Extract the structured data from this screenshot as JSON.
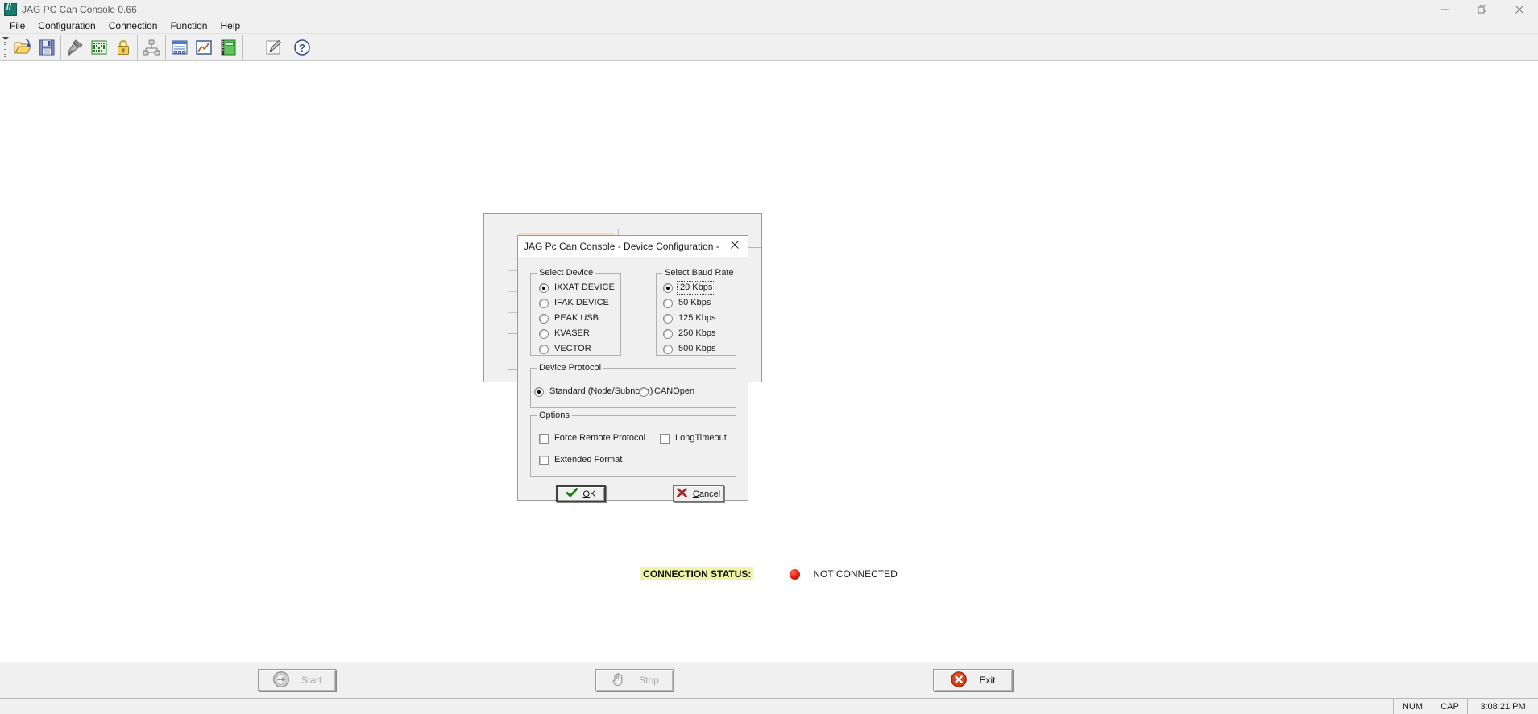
{
  "window": {
    "title": "JAG PC Can Console 0.66",
    "icon": "app-logo-icon",
    "controls": {
      "minimize": "minimize-icon",
      "restore": "restore-icon",
      "close": "close-icon"
    }
  },
  "menubar": {
    "items": [
      {
        "label": "File"
      },
      {
        "label": "Configuration"
      },
      {
        "label": "Connection"
      },
      {
        "label": "Function"
      },
      {
        "label": "Help"
      }
    ]
  },
  "toolbar": {
    "groups": [
      {
        "buttons": [
          {
            "name": "open-file-icon"
          },
          {
            "name": "save-file-icon"
          }
        ]
      },
      {
        "buttons": [
          {
            "name": "tools-hammer-icon"
          },
          {
            "name": "circuit-board-icon"
          },
          {
            "name": "padlock-icon"
          }
        ]
      },
      {
        "buttons": [
          {
            "name": "network-nodes-icon"
          }
        ]
      },
      {
        "buttons": [
          {
            "name": "list-report-icon"
          },
          {
            "name": "line-chart-icon"
          },
          {
            "name": "green-book-icon"
          }
        ]
      },
      {
        "buttons": [
          {
            "name": "edit-pencil-icon"
          }
        ]
      },
      {
        "buttons": [
          {
            "name": "help-question-icon"
          }
        ]
      }
    ]
  },
  "dialog": {
    "title": "JAG Pc Can Console - Device Configuration -",
    "close_icon": "close-icon",
    "select_device": {
      "legend": "Select Device",
      "options": [
        {
          "label": "IXXAT DEVICE",
          "checked": true
        },
        {
          "label": "IFAK  DEVICE",
          "checked": false
        },
        {
          "label": "PEAK USB",
          "checked": false
        },
        {
          "label": "KVASER",
          "checked": false
        },
        {
          "label": "VECTOR",
          "checked": false
        }
      ]
    },
    "select_baud_rate": {
      "legend": "Select Baud Rate",
      "options": [
        {
          "label": "20  Kbps",
          "checked": true,
          "focused": true
        },
        {
          "label": "50  Kbps",
          "checked": false,
          "focused": false
        },
        {
          "label": "125  Kbps",
          "checked": false,
          "focused": false
        },
        {
          "label": "250  Kbps",
          "checked": false,
          "focused": false
        },
        {
          "label": "500  Kbps",
          "checked": false,
          "focused": false
        }
      ]
    },
    "device_protocol": {
      "legend": "Device Protocol",
      "options": [
        {
          "label": "Standard (Node/Subnode)",
          "checked": true
        },
        {
          "label": "CANOpen",
          "checked": false
        }
      ]
    },
    "options": {
      "legend": "Options",
      "checkboxes": [
        {
          "label": "Force Remote Protocol",
          "checked": false
        },
        {
          "label": "LongTimeout",
          "checked": false
        },
        {
          "label": "Extended Format",
          "checked": false
        }
      ]
    },
    "buttons": {
      "ok": {
        "label": "OK",
        "accel": "O",
        "icon": "green-check-icon",
        "default": true
      },
      "cancel": {
        "label": "Cancel",
        "accel": "C",
        "icon": "red-x-icon",
        "default": false
      }
    }
  },
  "connection_status": {
    "label": "CONNECTION STATUS:",
    "value": "NOT  CONNECTED",
    "led": "red-led-icon",
    "led_color": "#e01b0c",
    "highlight_color": "#eff4a8"
  },
  "action_bar": {
    "start": {
      "label": "Start",
      "icon": "arrow-right-circle-icon",
      "enabled": false
    },
    "stop": {
      "label": "Stop",
      "icon": "hand-stop-icon",
      "enabled": false
    },
    "exit": {
      "label": "Exit",
      "icon": "red-x-circle-icon",
      "enabled": true
    }
  },
  "statusbar": {
    "message": "",
    "blank": "",
    "num": "NUM",
    "cap": "CAP",
    "time": "3:08:21 PM"
  }
}
